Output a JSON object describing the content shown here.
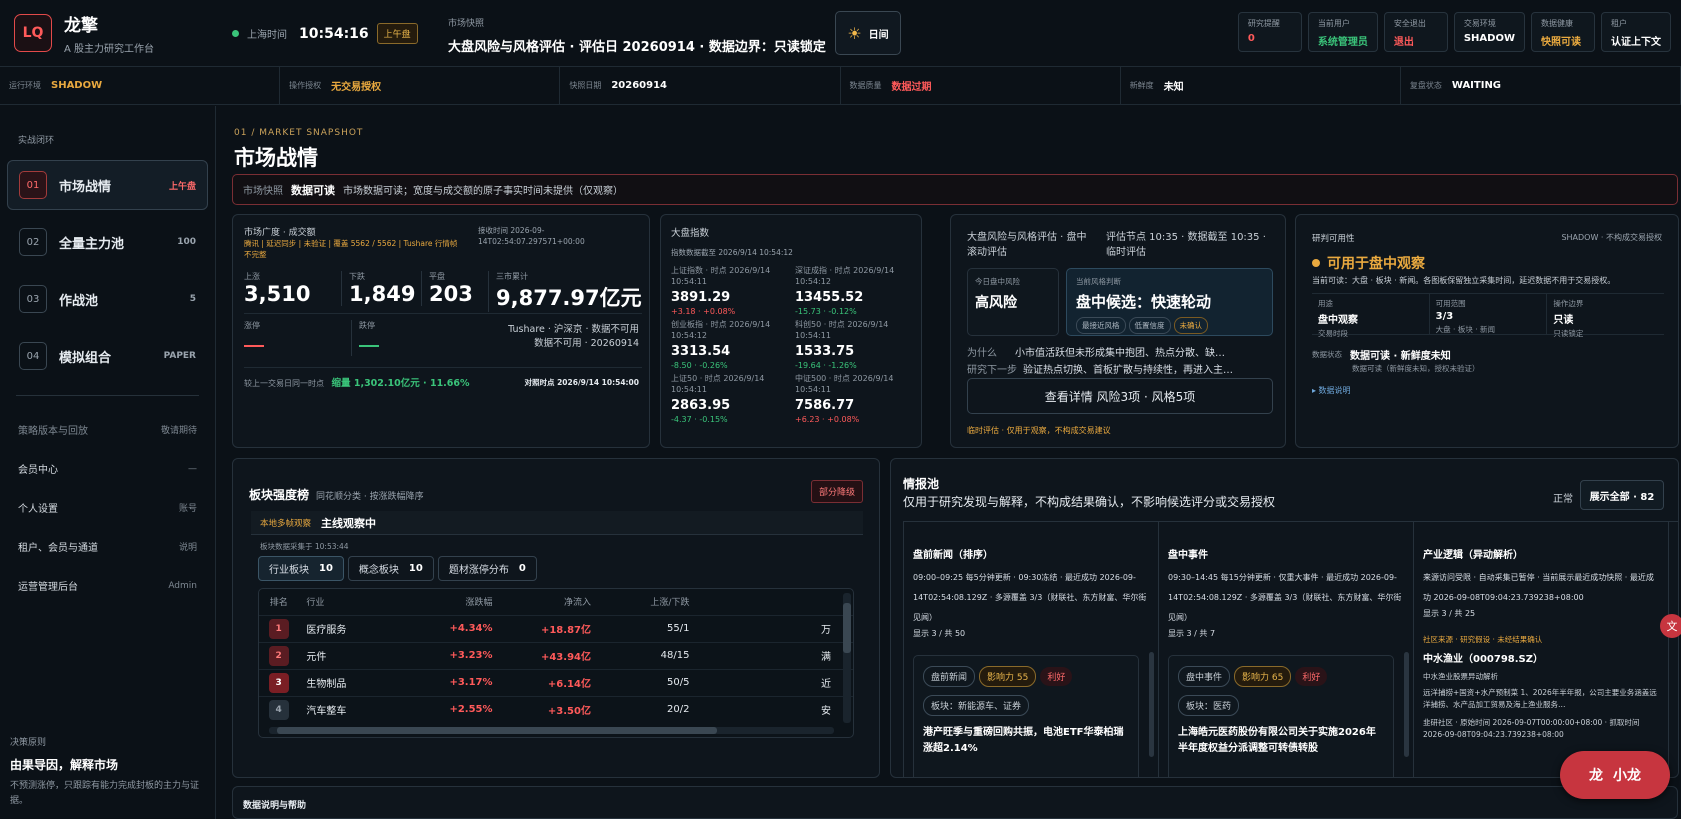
{
  "brand": {
    "logo": "LQ",
    "name": "龙擎",
    "sub": "A 股主力研究工作台"
  },
  "clock": {
    "label": "上海时间",
    "time": "10:54:16",
    "session": "上午盘"
  },
  "snapshot": {
    "label": "市场快照",
    "text": "大盘风险与风格评估 · 评估日 20260914 · 数据边界：只读锁定"
  },
  "day_button": "日间",
  "stats": [
    {
      "label": "研究提醒",
      "value": "0",
      "color": "#ff5a5a"
    },
    {
      "label": "当前用户",
      "value": "系统管理员",
      "color": "#3ac47a"
    },
    {
      "label": "安全退出",
      "value": "退出",
      "color": "#ff5a5a"
    },
    {
      "label": "交易环境",
      "value": "SHADOW",
      "color": "#ffffff"
    },
    {
      "label": "数据健康",
      "value": "快照可读",
      "color": "#e9a93f"
    },
    {
      "label": "租户",
      "value": "认证上下文",
      "color": "#ffffff"
    }
  ],
  "status_bar": [
    {
      "label": "运行环境",
      "value": "SHADOW",
      "color": "#e9a93f"
    },
    {
      "label": "操作授权",
      "value": "无交易授权",
      "color": "#e9a93f"
    },
    {
      "label": "快照日期",
      "value": "20260914",
      "color": "#ffffff"
    },
    {
      "label": "数据质量",
      "value": "数据过期",
      "color": "#ff5a5a"
    },
    {
      "label": "新鲜度",
      "value": "未知",
      "color": "#ffffff"
    },
    {
      "label": "复盘状态",
      "value": "WAITING",
      "color": "#ffffff"
    }
  ],
  "sidebar": {
    "section": "实战闭环",
    "items": [
      {
        "num": "01",
        "label": "市场战情",
        "badge": "上午盘"
      },
      {
        "num": "02",
        "label": "全量主力池",
        "badge": "100"
      },
      {
        "num": "03",
        "label": "作战池",
        "badge": "5"
      },
      {
        "num": "04",
        "label": "模拟组合",
        "badge": "PAPER"
      }
    ],
    "links": [
      {
        "label": "策略版本与回放",
        "right": "敬请期待",
        "dim": true
      },
      {
        "label": "会员中心",
        "right": "—",
        "dim": false
      },
      {
        "label": "个人设置",
        "right": "账号",
        "dim": false
      },
      {
        "label": "租户、会员与通道",
        "right": "说明",
        "dim": false
      },
      {
        "label": "运营管理后台",
        "right": "Admin",
        "dim": false
      }
    ],
    "principle": {
      "label": "决策原则",
      "title": "由果导因，解释市场",
      "desc": "不预测涨停，只跟踪有能力完成封板的主力与证据。"
    }
  },
  "page": {
    "kicker": "01 / MARKET SNAPSHOT",
    "title": "市场战情"
  },
  "notice": {
    "label": "市场快照",
    "status": "数据可读",
    "text": "市场数据可读；宽度与成交额的原子事实时间未提供（仅观察）"
  },
  "breadth": {
    "title": "市场广度 · 成交额",
    "source": "腾讯 | 延迟同步 | 未验证 | 覆盖 5562 / 5562 | Tushare 行情帧不完整",
    "recv": "接收时间 2026-09-14T02:54:07.297571+00:00",
    "up_label": "上涨",
    "up": "3,510",
    "down_label": "下跌",
    "down": "1,849",
    "flat_label": "平盘",
    "flat": "203",
    "amount_label": "三市累计",
    "amount": "9,877.97亿元",
    "limit_up_label": "涨停",
    "limit_down_label": "跌停",
    "tushare": "Tushare · 沪深京 · 数据不可用",
    "tushare2": "数据不可用 · 20260914",
    "compare_label": "较上一交易日同一时点",
    "compare": "缩量 1,302.10亿元 · 11.66%",
    "compare_time": "对照时点 2026/9/14 10:54:00"
  },
  "indices": {
    "title": "大盘指数",
    "time": "指数数据截至 2026/9/14 10:54:12",
    "items": [
      {
        "label": "上证指数 · 时点 2026/9/14 10:54:11",
        "value": "3891.29",
        "change": "+3.18 · +0.08%",
        "color": "#ff5a5a"
      },
      {
        "label": "深证成指 · 时点 2026/9/14 10:54:12",
        "value": "13455.52",
        "change": "-15.73 · -0.12%",
        "color": "#3ac47a"
      },
      {
        "label": "创业板指 · 时点 2026/9/14 10:54:12",
        "value": "3313.54",
        "change": "-8.50 · -0.26%",
        "color": "#3ac47a"
      },
      {
        "label": "科创50 · 时点 2026/9/14 10:54:11",
        "value": "1533.75",
        "change": "-19.64 · -1.26%",
        "color": "#3ac47a"
      },
      {
        "label": "上证50 · 时点 2026/9/14 10:54:11",
        "value": "2863.95",
        "change": "-4.37 · -0.15%",
        "color": "#3ac47a"
      },
      {
        "label": "中证500 · 时点 2026/9/14 10:54:11",
        "value": "7586.77",
        "change": "+6.23 · +0.08%",
        "color": "#ff5a5a"
      }
    ]
  },
  "risk": {
    "title": "大盘风险与风格评估 · 盘中滚动评估",
    "node": "评估节点 10:35 · 数据截至 10:35 · 临时评估",
    "risk_label": "今日盘中风险",
    "risk_value": "高风险",
    "style_label": "当前风格判断",
    "style_value": "盘中候选：快速轮动",
    "chips": [
      "最接近风格",
      "低置信度",
      "未确认"
    ],
    "why_label": "为什么",
    "why": "小市值活跃但未形成集中抱团、热点分散、缺…",
    "next_label": "研究下一步",
    "next": "验证热点切换、首板扩散与持续性，再进入主…",
    "button": "查看详情 风险3项 · 风格5项",
    "footer": "临时评估 · 仅用于观察，不构成交易建议"
  },
  "research": {
    "title": "研判可用性",
    "env": "SHADOW · 不构成交易授权",
    "headline": "可用于盘中观察",
    "desc": "当前可读：大盘 · 板块 · 新闻。各图板保留独立采集时间，延迟数据不用于交易授权。",
    "cells": [
      {
        "label": "用途",
        "value": "盘中观察",
        "sub": "交易时段"
      },
      {
        "label": "可用范围",
        "value": "3/3",
        "sub": "大盘 · 板块 · 新闻"
      },
      {
        "label": "操作边界",
        "value": "只读",
        "sub": "只读锁定"
      }
    ],
    "state_label": "数据状态",
    "state_value": "数据可读 · 新鲜度未知",
    "state_sub": "数据可读（新鲜度未知，授权未验证）",
    "link": "▸ 数据说明"
  },
  "sectors": {
    "title": "板块强度榜",
    "sub": "同花顺分类 · 按涨跌幅降序",
    "badge": "部分降级",
    "banner_label": "本地多帧观察",
    "banner_text": "主线观察中",
    "time": "板块数据采集于 10:53:44",
    "tabs": [
      {
        "label": "行业板块",
        "count": "10"
      },
      {
        "label": "概念板块",
        "count": "10"
      },
      {
        "label": "题材涨停分布",
        "count": "0"
      }
    ],
    "headers": [
      "排名",
      "行业",
      "涨跌幅",
      "净流入",
      "上涨/下跌",
      ""
    ],
    "rows": [
      {
        "rank": "1",
        "name": "医疗服务",
        "pct": "+4.34%",
        "flow": "+18.87亿",
        "ud": "55/1",
        "extra": "万"
      },
      {
        "rank": "2",
        "name": "元件",
        "pct": "+3.23%",
        "flow": "+43.94亿",
        "ud": "48/15",
        "extra": "满"
      },
      {
        "rank": "3",
        "name": "生物制品",
        "pct": "+3.17%",
        "flow": "+6.14亿",
        "ud": "50/5",
        "extra": "近"
      },
      {
        "rank": "4",
        "name": "汽车整车",
        "pct": "+2.55%",
        "flow": "+3.50亿",
        "ud": "20/2",
        "extra": "安"
      }
    ]
  },
  "intel": {
    "title": "情报池",
    "sub": "仅用于研究发现与解释，不构成结果确认，不影响候选评分或交易授权",
    "status": "正常",
    "button": "展示全部 · 82",
    "cols": [
      {
        "title": "盘前新闻（排序）",
        "desc": "09:00–09:25 每5分钟更新 · 09:30冻结 · 最近成功 2026-09-14T02:54:08.129Z · 多源覆盖 3/3（财联社、东方财富、华尔街见闻）",
        "count": "显示 3 / 共 50",
        "card": {
          "tag": "盘前新闻",
          "impact": "影响力 55",
          "sent": "利好",
          "sector": "板块：新能源车、证券",
          "headline": "港产旺季与重磅回购共振，电池ETF华泰柏瑞涨超2.14%"
        }
      },
      {
        "title": "盘中事件",
        "desc": "09:30–14:45 每15分钟更新 · 仅重大事件 · 最近成功 2026-09-14T02:54:08.129Z · 多源覆盖 3/3（财联社、东方财富、华尔街见闻）",
        "count": "显示 3 / 共 7",
        "card": {
          "tag": "盘中事件",
          "impact": "影响力 65",
          "sent": "利好",
          "sector": "板块：医药",
          "headline": "上海皓元医药股份有限公司关于实施2026年半年度权益分派调整可转债转股"
        }
      },
      {
        "title": "产业逻辑（异动解析）",
        "desc": "来源访问受限 · 自动采集已暂停 · 当前展示最近成功快照 · 最近成功 2026-09-08T09:04:23.739238+08:00",
        "count": "显示 3 / 共 25",
        "card": {
          "tag": "社区来源 · 研究假设 · 未经结果确认",
          "stock": "中水渔业（000798.SZ）",
          "sub": "中水渔业股票异动解析",
          "body": "远洋捕捞+国资+水产预制菜 1、2026年半年报，公司主要业务涵盖远洋捕捞、水产品加工贸易及海上渔业服务…",
          "meta": "韭研社区 · 原始时间 2026-09-07T00:00:00+08:00 · 抓取时间 2026-09-08T09:04:23.739238+08:00"
        }
      }
    ]
  },
  "footer_section": "数据说明与帮助",
  "assistant": {
    "icon": "龙",
    "label": "小龙"
  }
}
